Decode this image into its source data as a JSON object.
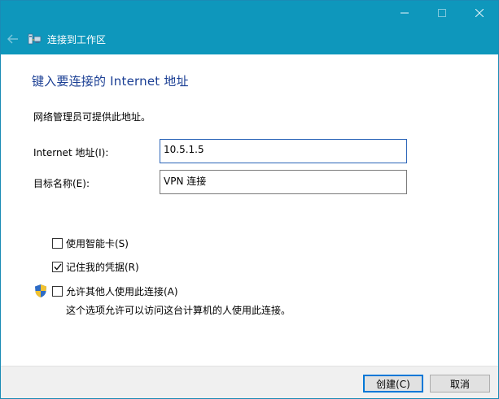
{
  "window": {
    "title": "连接到工作区",
    "controls": {
      "minimize": "minimize",
      "maximize": "maximize",
      "close": "close"
    }
  },
  "page": {
    "heading": "键入要连接的 Internet 地址",
    "subtitle": "网络管理员可提供此地址。"
  },
  "form": {
    "address_label": "Internet 地址(I):",
    "address_value": "10.5.1.5",
    "destination_label": "目标名称(E):",
    "destination_value": "VPN 连接"
  },
  "options": {
    "smart_card": {
      "label": "使用智能卡(S)",
      "checked": false
    },
    "remember_credentials": {
      "label": "记住我的凭据(R)",
      "checked": true
    },
    "allow_others": {
      "label": "允许其他人使用此连接(A)",
      "checked": false
    },
    "allow_others_note": "这个选项允许可以访问这台计算机的人使用此连接。"
  },
  "buttons": {
    "create": "创建(C)",
    "cancel": "取消"
  },
  "colors": {
    "titlebar": "#0e97bc",
    "heading": "#1b3f94",
    "focus_border": "#2b65b8"
  },
  "icons": [
    "back-arrow-icon",
    "network-connection-icon",
    "uac-shield-icon",
    "checkmark-icon"
  ]
}
